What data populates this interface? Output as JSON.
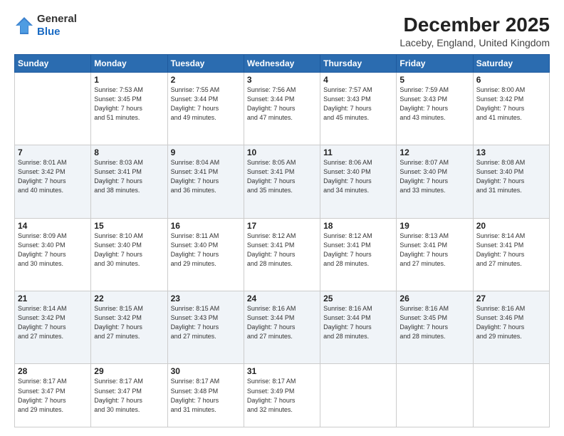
{
  "logo": {
    "general": "General",
    "blue": "Blue"
  },
  "header": {
    "month": "December 2025",
    "location": "Laceby, England, United Kingdom"
  },
  "weekdays": [
    "Sunday",
    "Monday",
    "Tuesday",
    "Wednesday",
    "Thursday",
    "Friday",
    "Saturday"
  ],
  "weeks": [
    [
      {
        "day": "",
        "sunrise": "",
        "sunset": "",
        "daylight": ""
      },
      {
        "day": "1",
        "sunrise": "Sunrise: 7:53 AM",
        "sunset": "Sunset: 3:45 PM",
        "daylight": "Daylight: 7 hours and 51 minutes."
      },
      {
        "day": "2",
        "sunrise": "Sunrise: 7:55 AM",
        "sunset": "Sunset: 3:44 PM",
        "daylight": "Daylight: 7 hours and 49 minutes."
      },
      {
        "day": "3",
        "sunrise": "Sunrise: 7:56 AM",
        "sunset": "Sunset: 3:44 PM",
        "daylight": "Daylight: 7 hours and 47 minutes."
      },
      {
        "day": "4",
        "sunrise": "Sunrise: 7:57 AM",
        "sunset": "Sunset: 3:43 PM",
        "daylight": "Daylight: 7 hours and 45 minutes."
      },
      {
        "day": "5",
        "sunrise": "Sunrise: 7:59 AM",
        "sunset": "Sunset: 3:43 PM",
        "daylight": "Daylight: 7 hours and 43 minutes."
      },
      {
        "day": "6",
        "sunrise": "Sunrise: 8:00 AM",
        "sunset": "Sunset: 3:42 PM",
        "daylight": "Daylight: 7 hours and 41 minutes."
      }
    ],
    [
      {
        "day": "7",
        "sunrise": "Sunrise: 8:01 AM",
        "sunset": "Sunset: 3:42 PM",
        "daylight": "Daylight: 7 hours and 40 minutes."
      },
      {
        "day": "8",
        "sunrise": "Sunrise: 8:03 AM",
        "sunset": "Sunset: 3:41 PM",
        "daylight": "Daylight: 7 hours and 38 minutes."
      },
      {
        "day": "9",
        "sunrise": "Sunrise: 8:04 AM",
        "sunset": "Sunset: 3:41 PM",
        "daylight": "Daylight: 7 hours and 36 minutes."
      },
      {
        "day": "10",
        "sunrise": "Sunrise: 8:05 AM",
        "sunset": "Sunset: 3:41 PM",
        "daylight": "Daylight: 7 hours and 35 minutes."
      },
      {
        "day": "11",
        "sunrise": "Sunrise: 8:06 AM",
        "sunset": "Sunset: 3:40 PM",
        "daylight": "Daylight: 7 hours and 34 minutes."
      },
      {
        "day": "12",
        "sunrise": "Sunrise: 8:07 AM",
        "sunset": "Sunset: 3:40 PM",
        "daylight": "Daylight: 7 hours and 33 minutes."
      },
      {
        "day": "13",
        "sunrise": "Sunrise: 8:08 AM",
        "sunset": "Sunset: 3:40 PM",
        "daylight": "Daylight: 7 hours and 31 minutes."
      }
    ],
    [
      {
        "day": "14",
        "sunrise": "Sunrise: 8:09 AM",
        "sunset": "Sunset: 3:40 PM",
        "daylight": "Daylight: 7 hours and 30 minutes."
      },
      {
        "day": "15",
        "sunrise": "Sunrise: 8:10 AM",
        "sunset": "Sunset: 3:40 PM",
        "daylight": "Daylight: 7 hours and 30 minutes."
      },
      {
        "day": "16",
        "sunrise": "Sunrise: 8:11 AM",
        "sunset": "Sunset: 3:40 PM",
        "daylight": "Daylight: 7 hours and 29 minutes."
      },
      {
        "day": "17",
        "sunrise": "Sunrise: 8:12 AM",
        "sunset": "Sunset: 3:41 PM",
        "daylight": "Daylight: 7 hours and 28 minutes."
      },
      {
        "day": "18",
        "sunrise": "Sunrise: 8:12 AM",
        "sunset": "Sunset: 3:41 PM",
        "daylight": "Daylight: 7 hours and 28 minutes."
      },
      {
        "day": "19",
        "sunrise": "Sunrise: 8:13 AM",
        "sunset": "Sunset: 3:41 PM",
        "daylight": "Daylight: 7 hours and 27 minutes."
      },
      {
        "day": "20",
        "sunrise": "Sunrise: 8:14 AM",
        "sunset": "Sunset: 3:41 PM",
        "daylight": "Daylight: 7 hours and 27 minutes."
      }
    ],
    [
      {
        "day": "21",
        "sunrise": "Sunrise: 8:14 AM",
        "sunset": "Sunset: 3:42 PM",
        "daylight": "Daylight: 7 hours and 27 minutes."
      },
      {
        "day": "22",
        "sunrise": "Sunrise: 8:15 AM",
        "sunset": "Sunset: 3:42 PM",
        "daylight": "Daylight: 7 hours and 27 minutes."
      },
      {
        "day": "23",
        "sunrise": "Sunrise: 8:15 AM",
        "sunset": "Sunset: 3:43 PM",
        "daylight": "Daylight: 7 hours and 27 minutes."
      },
      {
        "day": "24",
        "sunrise": "Sunrise: 8:16 AM",
        "sunset": "Sunset: 3:44 PM",
        "daylight": "Daylight: 7 hours and 27 minutes."
      },
      {
        "day": "25",
        "sunrise": "Sunrise: 8:16 AM",
        "sunset": "Sunset: 3:44 PM",
        "daylight": "Daylight: 7 hours and 28 minutes."
      },
      {
        "day": "26",
        "sunrise": "Sunrise: 8:16 AM",
        "sunset": "Sunset: 3:45 PM",
        "daylight": "Daylight: 7 hours and 28 minutes."
      },
      {
        "day": "27",
        "sunrise": "Sunrise: 8:16 AM",
        "sunset": "Sunset: 3:46 PM",
        "daylight": "Daylight: 7 hours and 29 minutes."
      }
    ],
    [
      {
        "day": "28",
        "sunrise": "Sunrise: 8:17 AM",
        "sunset": "Sunset: 3:47 PM",
        "daylight": "Daylight: 7 hours and 29 minutes."
      },
      {
        "day": "29",
        "sunrise": "Sunrise: 8:17 AM",
        "sunset": "Sunset: 3:47 PM",
        "daylight": "Daylight: 7 hours and 30 minutes."
      },
      {
        "day": "30",
        "sunrise": "Sunrise: 8:17 AM",
        "sunset": "Sunset: 3:48 PM",
        "daylight": "Daylight: 7 hours and 31 minutes."
      },
      {
        "day": "31",
        "sunrise": "Sunrise: 8:17 AM",
        "sunset": "Sunset: 3:49 PM",
        "daylight": "Daylight: 7 hours and 32 minutes."
      },
      {
        "day": "",
        "sunrise": "",
        "sunset": "",
        "daylight": ""
      },
      {
        "day": "",
        "sunrise": "",
        "sunset": "",
        "daylight": ""
      },
      {
        "day": "",
        "sunrise": "",
        "sunset": "",
        "daylight": ""
      }
    ]
  ]
}
